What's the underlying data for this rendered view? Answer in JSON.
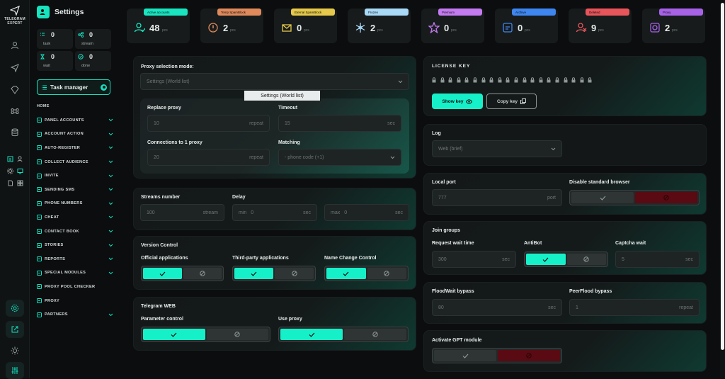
{
  "app": {
    "name": "TELEGRAM EXPERT",
    "page_title": "Settings"
  },
  "stats": [
    {
      "value": "0",
      "label": "task"
    },
    {
      "value": "0",
      "label": "stream"
    },
    {
      "value": "0",
      "label": "wait"
    },
    {
      "value": "0",
      "label": "done"
    }
  ],
  "task_manager": {
    "label": "Task manager"
  },
  "nav": {
    "home": "HOME",
    "items": [
      "PANEL ACCOUNTS",
      "ACCOUNT ACTION",
      "AUTO-REGISTER",
      "COLLECT AUDIENCE",
      "INVITE",
      "SENDING SMS",
      "PHONE NUMBERS",
      "CHEAT",
      "CONTACT BOOK",
      "STORIES",
      "REPORTS",
      "SPECIAL MODULES",
      "PROXY POOL CHECKER",
      "PROXY",
      "PARTNERS"
    ]
  },
  "top_cards": [
    {
      "badge": "Active accounts",
      "value": "48",
      "unit": "pcs",
      "color": "#19e6c1"
    },
    {
      "badge": "Temp SpamBlock",
      "value": "2",
      "unit": "pcs",
      "color": "#e08a5c"
    },
    {
      "badge": "Eternal SpamBlock",
      "value": "0",
      "unit": "pcs",
      "color": "#e6c94a"
    },
    {
      "badge": "Frozen",
      "value": "2",
      "unit": "pcs",
      "color": "#a8d9f7"
    },
    {
      "badge": "Premium",
      "value": "0",
      "unit": "pcs",
      "color": "#c47af0"
    },
    {
      "badge": "Archive",
      "value": "0",
      "unit": "pcs",
      "color": "#3e86f0"
    },
    {
      "badge": "Deleted",
      "value": "9",
      "unit": "pcs",
      "color": "#e8555a"
    },
    {
      "badge": "Proxy",
      "value": "2",
      "unit": "pcs",
      "color": "#a762e8"
    }
  ],
  "proxy": {
    "mode_label": "Proxy selection mode:",
    "mode_value": "Settings (World list)",
    "tooltip": "Settings (World list)",
    "replace_label": "Replace proxy",
    "replace_value": "10",
    "replace_unit": "repeat",
    "timeout_label": "Timeout",
    "timeout_value": "15",
    "timeout_unit": "sec",
    "conn_label": "Connections to 1 proxy",
    "conn_value": "20",
    "conn_unit": "repeat",
    "matching_label": "Matching",
    "matching_value": "- phone code (+1)"
  },
  "streams": {
    "label": "Streams number",
    "value": "100",
    "unit": "stream",
    "delay_label": "Delay",
    "min_prefix": "min",
    "min_value": "0",
    "min_unit": "sec",
    "max_prefix": "max",
    "max_value": "0",
    "max_unit": "sec"
  },
  "version": {
    "title": "Version Control",
    "official": "Official applications",
    "third": "Third-party applications",
    "namechange": "Name Change Control"
  },
  "web": {
    "title": "Telegram WEB",
    "param": "Parameter control",
    "useproxy": "Use proxy"
  },
  "license": {
    "title": "LICENSE KEY",
    "show": "Show key",
    "copy": "Copy key"
  },
  "log": {
    "label": "Log",
    "value": "Web (brief)"
  },
  "port": {
    "label": "Local port",
    "value": "777",
    "unit": "port",
    "browser_label": "Disable standard browser"
  },
  "join": {
    "title": "Join groups",
    "req_label": "Request wait time",
    "req_value": "300",
    "req_unit": "sec",
    "antibot_label": "AntiBot",
    "captcha_label": "Captcha wait",
    "captcha_value": "5",
    "captcha_unit": "sec"
  },
  "flood": {
    "label": "FloodWait bypass",
    "value": "80",
    "unit": "sec",
    "peer_label": "PeerFlood bypass",
    "peer_value": "1",
    "peer_unit": "repeat"
  },
  "gpt": {
    "label": "Activate GPT module"
  }
}
